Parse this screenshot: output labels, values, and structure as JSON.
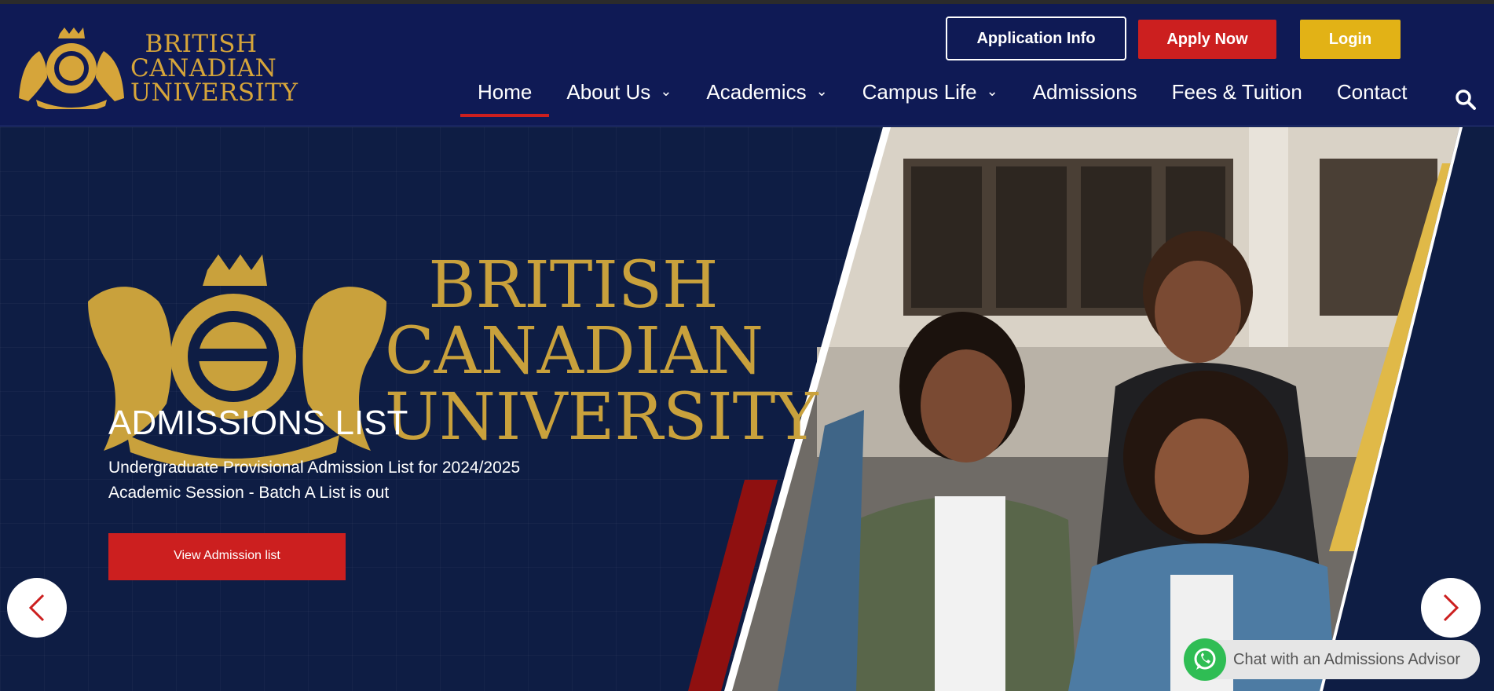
{
  "brand": {
    "name_line1": "BRITISH",
    "name_line2": "CANADIAN",
    "name_line3": "UNIVERSITY",
    "gold": "#d6a53a",
    "navy": "#0f1a55",
    "red": "#cc1f1f",
    "yellow": "#e2b216"
  },
  "header": {
    "buttons": {
      "application_info": "Application Info",
      "apply_now": "Apply Now",
      "login": "Login"
    },
    "nav": [
      {
        "label": "Home",
        "active": true,
        "dropdown": false
      },
      {
        "label": "About Us",
        "active": false,
        "dropdown": true
      },
      {
        "label": "Academics",
        "active": false,
        "dropdown": true
      },
      {
        "label": "Campus Life",
        "active": false,
        "dropdown": true
      },
      {
        "label": "Admissions",
        "active": false,
        "dropdown": false
      },
      {
        "label": "Fees & Tuition",
        "active": false,
        "dropdown": false
      },
      {
        "label": "Contact",
        "active": false,
        "dropdown": false
      }
    ],
    "search_icon": "search-icon"
  },
  "hero": {
    "logo_line1": "BRITISH",
    "logo_line2": "CANADIAN",
    "logo_line3": "UNIVERSITY",
    "title": "ADMISSIONS LIST",
    "description_line1": "Undergraduate Provisional Admission List for 2024/2025",
    "description_line2": "Academic Session - Batch A List is out",
    "cta": "View Admission list",
    "prev_icon": "chevron-left-icon",
    "next_icon": "chevron-right-icon"
  },
  "chat": {
    "label": "Chat with an Admissions Advisor",
    "icon": "whatsapp-icon"
  }
}
